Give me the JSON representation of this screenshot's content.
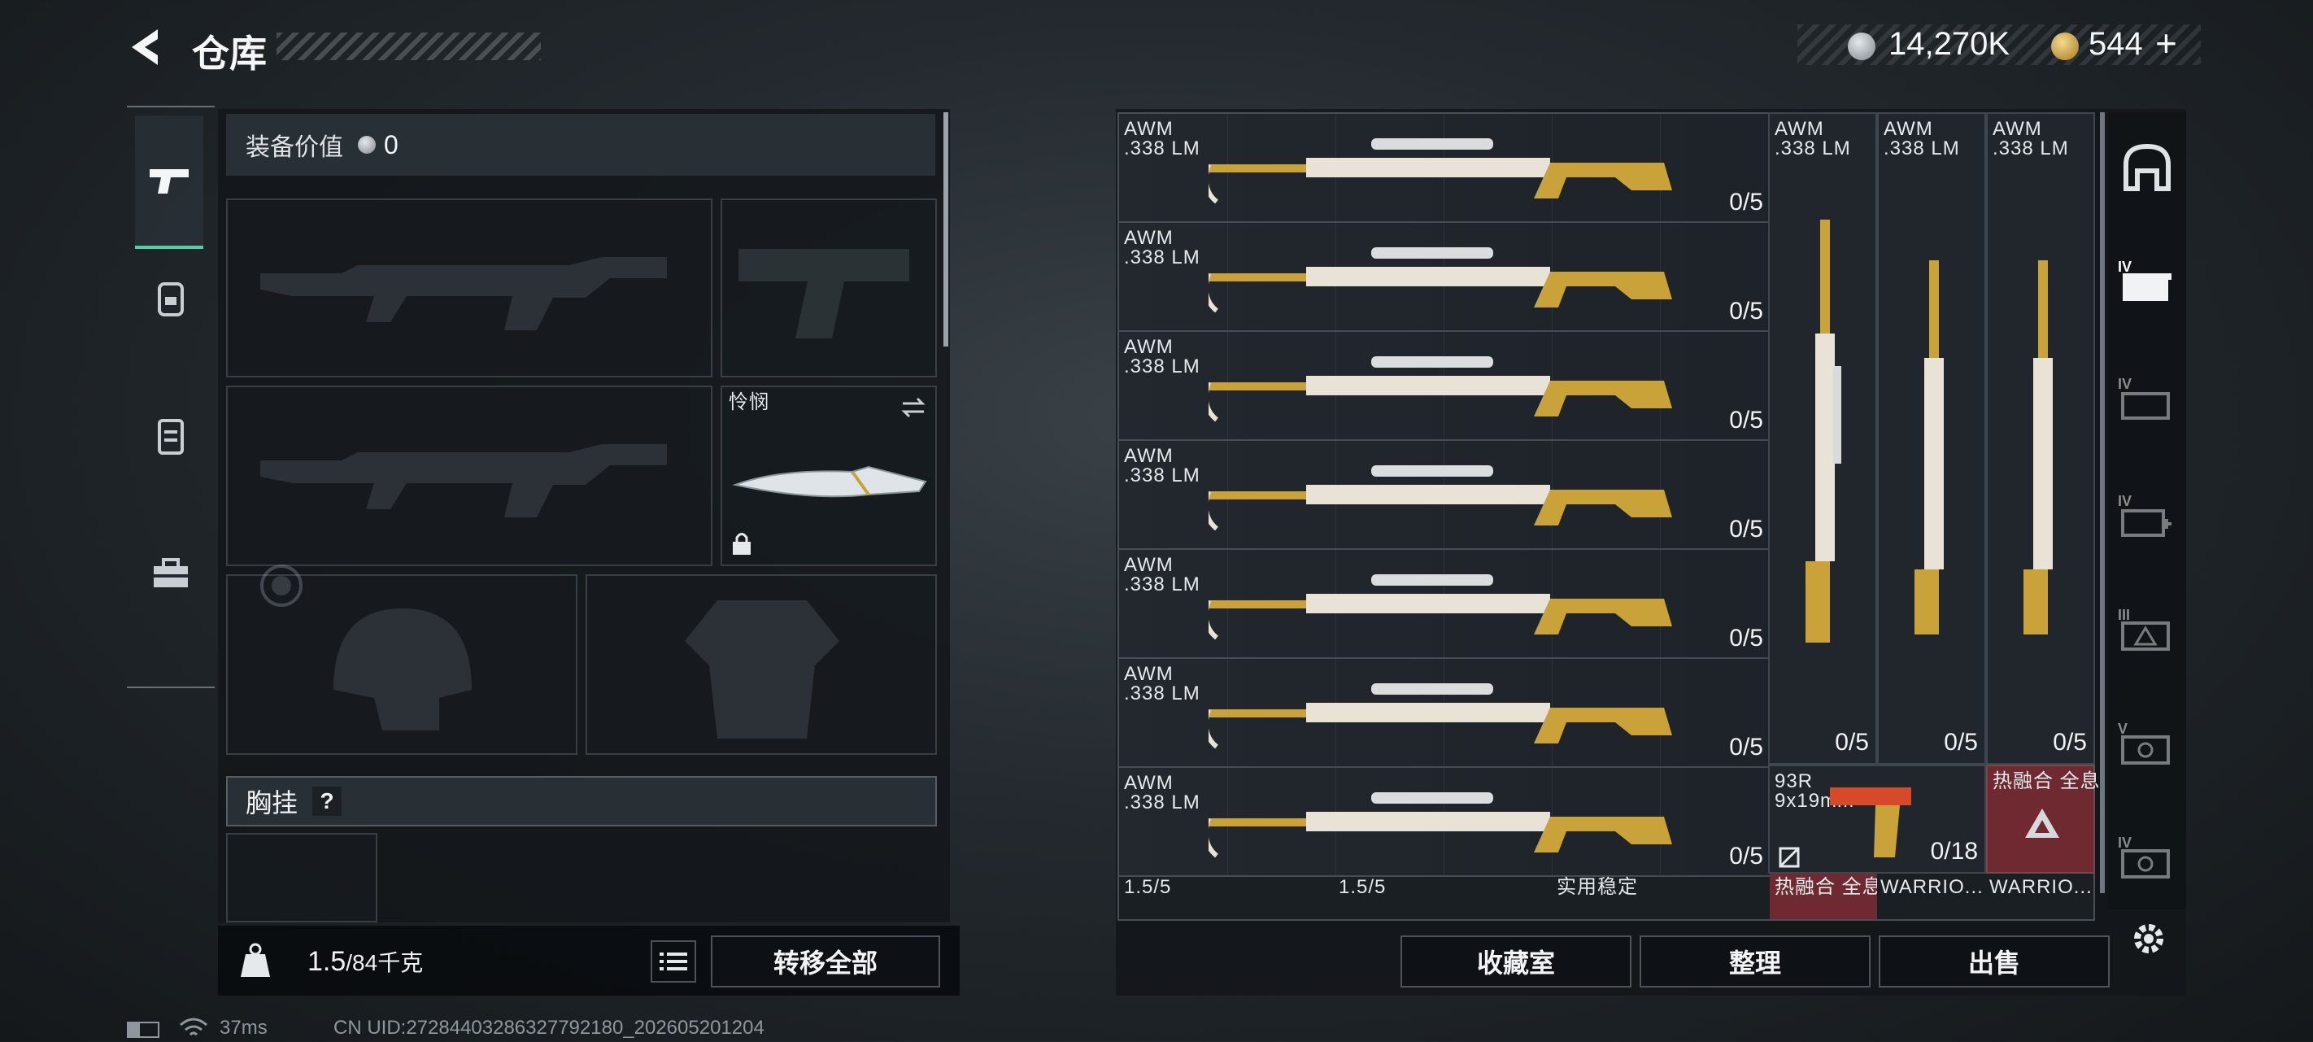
{
  "header": {
    "title": "仓库",
    "silver_amount": "14,270K",
    "gold_amount": "544",
    "gold_plus": "+"
  },
  "left_panel": {
    "equip_value_label": "装备价值",
    "equip_value": "0",
    "melee_name": "怜悯",
    "chest_label": "胸挂",
    "chest_help": "?",
    "weight_value": "1.5",
    "weight_capacity": "/84千克",
    "transfer_all": "转移全部"
  },
  "stash": {
    "rows": [
      {
        "name": "AWM",
        "ammo": ".338 LM",
        "count": "0/5"
      },
      {
        "name": "AWM",
        "ammo": ".338 LM",
        "count": "0/5"
      },
      {
        "name": "AWM",
        "ammo": ".338 LM",
        "count": "0/5"
      },
      {
        "name": "AWM",
        "ammo": ".338 LM",
        "count": "0/5"
      },
      {
        "name": "AWM",
        "ammo": ".338 LM",
        "count": "0/5"
      },
      {
        "name": "AWM",
        "ammo": ".338 LM",
        "count": "0/5"
      },
      {
        "name": "AWM",
        "ammo": ".338 LM",
        "count": "0/5"
      }
    ],
    "vertical": [
      {
        "name": "AWM",
        "ammo": ".338 LM",
        "count": "0/5"
      },
      {
        "name": "AWM",
        "ammo": ".338 LM",
        "count": "0/5"
      },
      {
        "name": "AWM",
        "ammo": ".338 LM",
        "count": "0/5"
      }
    ],
    "pistol": {
      "name": "93R",
      "ammo": "9x19mm",
      "count": "0/18"
    },
    "fusion_top": "热融合 全息",
    "bottom_row": [
      "1.5/5",
      "1.5/5",
      "实用稳定",
      "热融合 全息",
      "WARRIO...",
      "WARRIO..."
    ]
  },
  "actions": {
    "collection": "收藏室",
    "organize": "整理",
    "sell": "出售"
  },
  "status": {
    "ping": "37ms",
    "uid": "CN UID:27284403286327792180_202605201204"
  },
  "tiers": [
    "IV",
    "IV",
    "IV",
    "III",
    "V",
    "IV"
  ],
  "colors": {
    "gold": "#c9a23a",
    "accent_green": "#4fd1a5",
    "fusion_red": "#7a2a2f"
  }
}
